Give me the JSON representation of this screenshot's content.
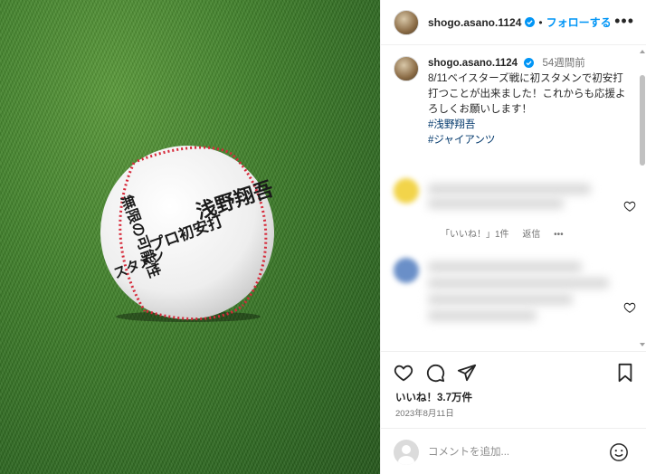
{
  "photo": {
    "ball_signature": [
      "浅野翔吾",
      "無限の可能性",
      "プロ初安打",
      "スタメン"
    ]
  },
  "header": {
    "username": "shogo.asano.1124",
    "separator": "•",
    "follow_label": "フォローする",
    "more_label": "•••"
  },
  "caption": {
    "username": "shogo.asano.1124",
    "age": "54週間前",
    "text": "8/11ベイスターズ戦に初スタメンで初安打打つことが出来ました！これからも応援よろしくお願いします！",
    "hashtags": [
      "#浅野翔吾",
      "#ジャイアンツ"
    ]
  },
  "comments": [
    {
      "like_count": "「いいね！」1件",
      "reply_label": "返信",
      "more_label": "•••"
    }
  ],
  "actions": {
    "likes": "いいね！3.7万件",
    "date": "2023年8月11日"
  },
  "comment_bar": {
    "placeholder": "コメントを追加..."
  },
  "colors": {
    "accent": "#0095f6",
    "hashtag": "#00376b",
    "muted": "#737373"
  }
}
